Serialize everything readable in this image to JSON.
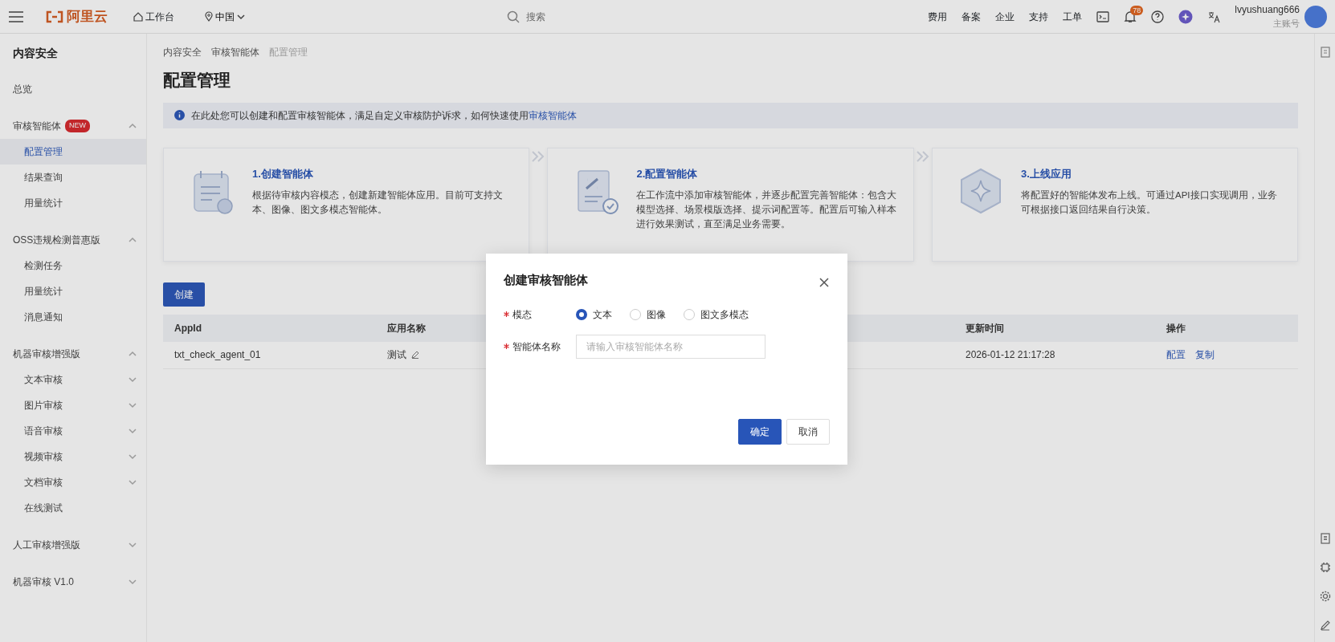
{
  "topbar": {
    "logo": "阿里云",
    "workbench": "工作台",
    "region": "中国",
    "search": {
      "placeholder": "搜索"
    },
    "links": [
      "费用",
      "备案",
      "企业",
      "支持",
      "工单"
    ],
    "notifications": "78",
    "user": {
      "name": "lvyushuang666",
      "role": "主账号"
    }
  },
  "sidebar": {
    "title": "内容安全",
    "items": [
      {
        "label": "总览"
      },
      {
        "label": "审核智能体",
        "badge": "NEW",
        "expanded": true,
        "children": [
          {
            "label": "配置管理",
            "selected": true
          },
          {
            "label": "结果查询",
            "selected": false
          },
          {
            "label": "用量统计",
            "selected": false
          }
        ]
      },
      {
        "label": "OSS违规检测普惠版",
        "expanded": true,
        "children": [
          {
            "label": "检测任务",
            "selected": false
          },
          {
            "label": "用量统计",
            "selected": false
          },
          {
            "label": "消息通知",
            "selected": false
          }
        ]
      },
      {
        "label": "机器审核增强版",
        "expanded": true,
        "children": [
          {
            "label": "文本审核",
            "selected": false,
            "expanded": false
          },
          {
            "label": "图片审核",
            "selected": false,
            "expanded": false
          },
          {
            "label": "语音审核",
            "selected": false,
            "expanded": false
          },
          {
            "label": "视频审核",
            "selected": false,
            "expanded": false
          },
          {
            "label": "文档审核",
            "selected": false,
            "expanded": false
          },
          {
            "label": "在线测试",
            "selected": false
          }
        ]
      },
      {
        "label": "人工审核增强版",
        "expanded": false
      },
      {
        "label": "机器审核 V1.0",
        "expanded": false
      }
    ]
  },
  "breadcrumb": [
    "内容安全",
    "审核智能体",
    "配置管理"
  ],
  "page_title": "配置管理",
  "notice": {
    "text": "在此处您可以创建和配置审核智能体，满足自定义审核防护诉求，如何快速使用",
    "link": "审核智能体"
  },
  "steps": [
    {
      "kind": "calendar",
      "title": "1.创建智能体",
      "text": "根据待审核内容模态，创建新建智能体应用。目前可支持文本、图像、图文多模态智能体。"
    },
    {
      "kind": "document",
      "title": "2.配置智能体",
      "text": "在工作流中添加审核智能体，并逐步配置完善智能体：包含大模型选择、场景模版选择、提示词配置等。配置后可输入样本进行效果测试，直至满足业务需要。"
    },
    {
      "kind": "hexagon",
      "title": "3.上线应用",
      "text": "将配置好的智能体发布上线。可通过API接口实现调用，业务可根据接口返回结果自行决策。"
    }
  ],
  "create_button": "创建",
  "table": {
    "columns": [
      {
        "label": "AppId"
      },
      {
        "label": "应用名称"
      },
      {
        "label": "更新时间"
      },
      {
        "label": "操作"
      }
    ],
    "rows": [
      {
        "app_id": "txt_check_agent_01",
        "name": "测试",
        "updated": "2026-01-12 21:17:28",
        "actions": [
          "配置",
          "复制"
        ]
      }
    ]
  },
  "dialog": {
    "title": "创建审核智能体",
    "fields": [
      {
        "kind": "radio",
        "label": "模态",
        "required": true,
        "options": [
          {
            "label": "文本",
            "selected": true
          },
          {
            "label": "图像",
            "selected": false
          },
          {
            "label": "图文多模态",
            "selected": false
          }
        ]
      },
      {
        "kind": "text",
        "label": "智能体名称",
        "required": true,
        "placeholder": "请输入审核智能体名称"
      }
    ],
    "buttons": [
      {
        "label": "确定",
        "kind": "primary"
      },
      {
        "label": "取消",
        "kind": "secondary"
      }
    ]
  }
}
